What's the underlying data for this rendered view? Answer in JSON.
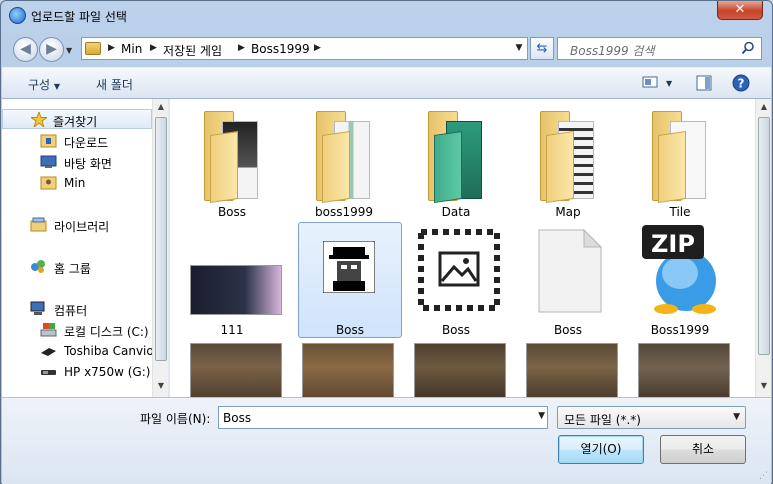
{
  "window": {
    "title": "업로드할 파일 선택",
    "close_symbol": "✕"
  },
  "address": {
    "crumbs": [
      "Min",
      "저장된 게임",
      "Boss1999"
    ],
    "search_placeholder": "Boss1999 검색"
  },
  "toolbar": {
    "organize": "구성",
    "new_folder": "새 폴더"
  },
  "nav": {
    "favorites": "즐겨찾기",
    "downloads": "다운로드",
    "desktop": "바탕 화면",
    "min": "Min",
    "libraries": "라이브러리",
    "homegroup": "홈 그룹",
    "computer": "컴퓨터",
    "local_disk": "로컬 디스크 (C:)",
    "toshiba": "Toshiba Canvio I",
    "hp": "HP x750w (G:)"
  },
  "files": {
    "row1": [
      "Boss",
      "boss1999",
      "Data",
      "Map",
      "Tile"
    ],
    "row2": [
      "111",
      "Boss",
      "Boss",
      "Boss",
      "Boss1999"
    ],
    "zip_text": "ZIP"
  },
  "bottom": {
    "filename_label": "파일 이름(N):",
    "filename_value": "Boss",
    "filter_value": "모든 파일 (*.*)",
    "open_label": "열기(O)",
    "cancel_label": "취소"
  },
  "colors": {
    "accent": "#3c7fb1",
    "selection": "#cfe3fb",
    "folder": "#f0d07e"
  }
}
